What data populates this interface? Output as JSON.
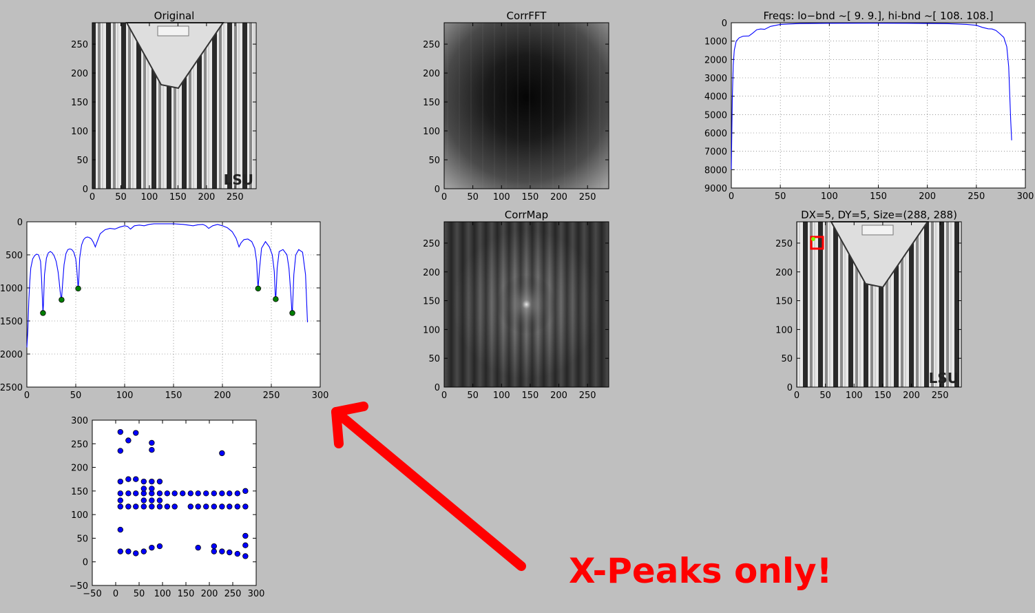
{
  "annotation": "X-Peaks only!",
  "colors": {
    "background": "#bfbfbf",
    "line": "#0000ff",
    "peak_marker": "#007f00",
    "scatter_marker": "#0000ff",
    "annotation": "#ff0000",
    "roi_box": "#ff0000",
    "roi_point": "#7fff00"
  },
  "chart_data": [
    {
      "id": "original",
      "type": "image",
      "title": "Original",
      "image": "grayscale photo of a striped shirt",
      "xlim": [
        0,
        287
      ],
      "ylim": [
        287,
        0
      ],
      "xticks": [
        0,
        50,
        100,
        150,
        200,
        250
      ],
      "yticks": [
        0,
        50,
        100,
        150,
        200,
        250
      ]
    },
    {
      "id": "corrfft",
      "type": "image",
      "title": "CorrFFT",
      "image": "grayscale FFT magnitude (dark center, bright edges)",
      "xlim": [
        0,
        287
      ],
      "ylim": [
        287,
        0
      ],
      "xticks": [
        0,
        50,
        100,
        150,
        200,
        250
      ],
      "yticks": [
        0,
        50,
        100,
        150,
        200,
        250
      ]
    },
    {
      "id": "freqs",
      "type": "line",
      "title": "Freqs: lo-bnd ~[ 9.  9.], hi-bnd ~[ 108.  108.]",
      "xlim": [
        0,
        300
      ],
      "ylim": [
        0,
        9000
      ],
      "xticks": [
        0,
        50,
        100,
        150,
        200,
        250,
        300
      ],
      "yticks": [
        0,
        1000,
        2000,
        3000,
        4000,
        5000,
        6000,
        7000,
        8000,
        9000
      ],
      "grid": true,
      "x": [
        0,
        1,
        2,
        3,
        5,
        8,
        12,
        18,
        22,
        26,
        30,
        34,
        40,
        50,
        70,
        100,
        140,
        180,
        220,
        240,
        250,
        256,
        262,
        266,
        270,
        274,
        278,
        281,
        283,
        284,
        285,
        286
      ],
      "y": [
        8000,
        4200,
        2300,
        1500,
        1000,
        820,
        730,
        720,
        560,
        380,
        340,
        360,
        200,
        90,
        45,
        30,
        25,
        30,
        50,
        90,
        140,
        250,
        330,
        340,
        420,
        600,
        800,
        1300,
        2400,
        3800,
        5300,
        6400
      ]
    },
    {
      "id": "xprofile",
      "type": "line",
      "title": "",
      "xlim": [
        0,
        300
      ],
      "ylim": [
        0,
        2500
      ],
      "xticks": [
        0,
        50,
        100,
        150,
        200,
        250,
        300
      ],
      "yticks": [
        0,
        500,
        1000,
        1500,
        2000,
        2500
      ],
      "grid": true,
      "x": [
        0,
        1,
        2,
        3,
        4,
        6,
        8,
        10,
        12,
        14,
        15,
        16,
        16.5,
        17,
        18,
        20,
        22,
        24,
        26,
        28,
        30,
        32,
        33,
        34,
        35,
        35.5,
        36,
        38,
        40,
        42,
        44,
        46,
        48,
        50,
        51,
        52,
        52.5,
        53,
        54,
        56,
        58,
        60,
        62,
        64,
        66,
        68,
        70,
        72,
        75,
        80,
        85,
        90,
        95,
        100,
        103,
        106,
        110,
        115,
        120,
        125,
        130,
        140,
        150,
        160,
        165,
        170,
        175,
        180,
        183,
        186,
        190,
        195,
        200,
        205,
        210,
        214,
        217,
        219,
        222,
        226,
        230,
        233,
        235,
        236,
        236.5,
        237,
        238,
        240,
        244,
        248,
        251,
        253,
        254,
        254.5,
        255,
        256,
        258,
        262,
        266,
        268,
        270,
        271,
        271.5,
        272,
        273,
        275,
        278,
        282,
        285,
        287
      ],
      "y": [
        1900,
        1650,
        1200,
        900,
        700,
        560,
        510,
        490,
        500,
        600,
        850,
        1200,
        1380,
        1250,
        800,
        550,
        470,
        450,
        470,
        520,
        600,
        760,
        900,
        1050,
        1150,
        1180,
        1050,
        650,
        480,
        420,
        410,
        420,
        460,
        560,
        700,
        900,
        1010,
        900,
        550,
        350,
        270,
        240,
        230,
        240,
        260,
        310,
        380,
        300,
        180,
        120,
        100,
        110,
        80,
        60,
        70,
        110,
        60,
        50,
        60,
        40,
        30,
        30,
        30,
        40,
        50,
        60,
        45,
        40,
        60,
        100,
        60,
        40,
        60,
        90,
        150,
        250,
        380,
        320,
        270,
        260,
        300,
        400,
        600,
        900,
        1000,
        900,
        700,
        400,
        300,
        380,
        500,
        750,
        1100,
        1170,
        1050,
        700,
        450,
        420,
        500,
        700,
        1100,
        1350,
        1380,
        1200,
        800,
        500,
        420,
        460,
        800,
        1520
      ],
      "peaks": [
        [
          16.5,
          1380
        ],
        [
          35.5,
          1180
        ],
        [
          52.5,
          1010
        ],
        [
          236.5,
          1010
        ],
        [
          254.5,
          1170
        ],
        [
          271.5,
          1380
        ]
      ]
    },
    {
      "id": "corrmap",
      "type": "image",
      "title": "CorrMap",
      "image": "grayscale autocorrelation map with vertical stripes",
      "xlim": [
        0,
        287
      ],
      "ylim": [
        287,
        0
      ],
      "xticks": [
        0,
        50,
        100,
        150,
        200,
        250
      ],
      "yticks": [
        0,
        50,
        100,
        150,
        200,
        250
      ]
    },
    {
      "id": "tile",
      "type": "image",
      "title": "DX=5, DY=5, Size=(288, 288)",
      "image": "striped shirt with small highlighted tile",
      "xlim": [
        0,
        287
      ],
      "ylim": [
        287,
        0
      ],
      "xticks": [
        0,
        50,
        100,
        150,
        200,
        250
      ],
      "yticks": [
        50,
        100,
        150,
        200,
        250
      ],
      "yticks_extra": [
        0
      ]
    },
    {
      "id": "scatter",
      "type": "scatter",
      "title": "",
      "xlim": [
        -50,
        300
      ],
      "ylim": [
        300,
        -50
      ],
      "xticks": [
        -50,
        0,
        50,
        100,
        150,
        200,
        250,
        300
      ],
      "yticks": [
        -50,
        0,
        50,
        100,
        150,
        200,
        250,
        300
      ],
      "points": [
        [
          10,
          22
        ],
        [
          27,
          22
        ],
        [
          43,
          18
        ],
        [
          60,
          22
        ],
        [
          77,
          30
        ],
        [
          94,
          33
        ],
        [
          176,
          30
        ],
        [
          210,
          22
        ],
        [
          210,
          33
        ],
        [
          227,
          22
        ],
        [
          243,
          20
        ],
        [
          260,
          17
        ],
        [
          277,
          12
        ],
        [
          277,
          35
        ],
        [
          277,
          55
        ],
        [
          10,
          68
        ],
        [
          10,
          117
        ],
        [
          27,
          117
        ],
        [
          43,
          117
        ],
        [
          60,
          117
        ],
        [
          77,
          117
        ],
        [
          94,
          117
        ],
        [
          110,
          117
        ],
        [
          126,
          117
        ],
        [
          160,
          117
        ],
        [
          176,
          117
        ],
        [
          193,
          117
        ],
        [
          210,
          117
        ],
        [
          227,
          117
        ],
        [
          243,
          117
        ],
        [
          260,
          117
        ],
        [
          277,
          117
        ],
        [
          10,
          130
        ],
        [
          60,
          130
        ],
        [
          77,
          130
        ],
        [
          94,
          130
        ],
        [
          10,
          145
        ],
        [
          27,
          145
        ],
        [
          43,
          145
        ],
        [
          60,
          145
        ],
        [
          77,
          145
        ],
        [
          94,
          145
        ],
        [
          110,
          145
        ],
        [
          126,
          145
        ],
        [
          143,
          145
        ],
        [
          160,
          145
        ],
        [
          176,
          145
        ],
        [
          193,
          145
        ],
        [
          210,
          145
        ],
        [
          227,
          145
        ],
        [
          243,
          145
        ],
        [
          260,
          145
        ],
        [
          277,
          150
        ],
        [
          60,
          155
        ],
        [
          77,
          155
        ],
        [
          10,
          170
        ],
        [
          27,
          175
        ],
        [
          43,
          175
        ],
        [
          60,
          170
        ],
        [
          77,
          170
        ],
        [
          94,
          170
        ],
        [
          10,
          235
        ],
        [
          77,
          237
        ],
        [
          227,
          230
        ],
        [
          77,
          252
        ],
        [
          27,
          257
        ],
        [
          10,
          275
        ],
        [
          43,
          273
        ]
      ]
    }
  ]
}
